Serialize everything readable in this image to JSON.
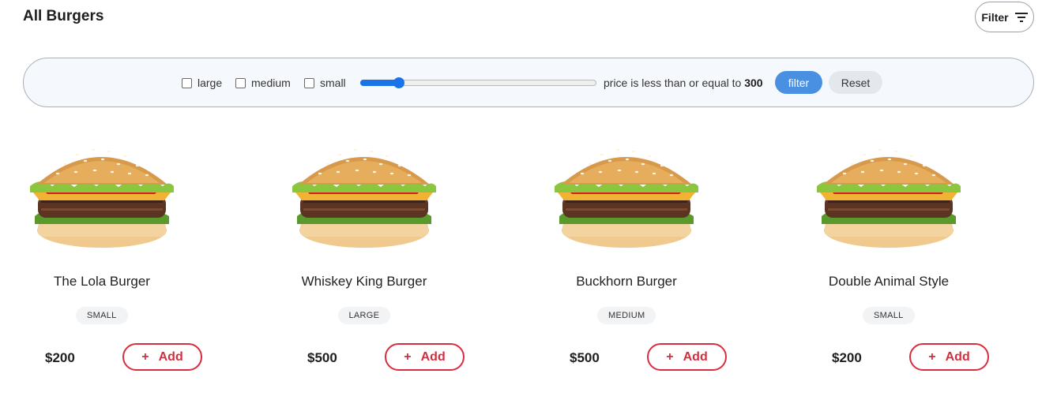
{
  "header": {
    "title": "All Burgers",
    "filter_label": "Filter"
  },
  "filter_bar": {
    "size_options": [
      {
        "label": "large",
        "checked": false
      },
      {
        "label": "medium",
        "checked": false
      },
      {
        "label": "small",
        "checked": false
      }
    ],
    "price_text": "price is less than or equal to",
    "price_value": "300",
    "slider_fraction": 0.14,
    "filter_button": "filter",
    "reset_button": "Reset"
  },
  "products": [
    {
      "name": "The Lola Burger",
      "size": "SMALL",
      "price": "$200",
      "add_label": "Add"
    },
    {
      "name": "Whiskey King Burger",
      "size": "LARGE",
      "price": "$500",
      "add_label": "Add"
    },
    {
      "name": "Buckhorn Burger",
      "size": "MEDIUM",
      "price": "$500",
      "add_label": "Add"
    },
    {
      "name": "Double Animal Style",
      "size": "SMALL",
      "price": "$200",
      "add_label": "Add"
    }
  ],
  "colors": {
    "accent_blue": "#4a90e2",
    "add_red": "#d32f3f",
    "slider_blue": "#1a73e8"
  },
  "icons": {
    "filter": "filter-lines-icon",
    "add": "plus-icon",
    "product_image": "burger-icon"
  }
}
